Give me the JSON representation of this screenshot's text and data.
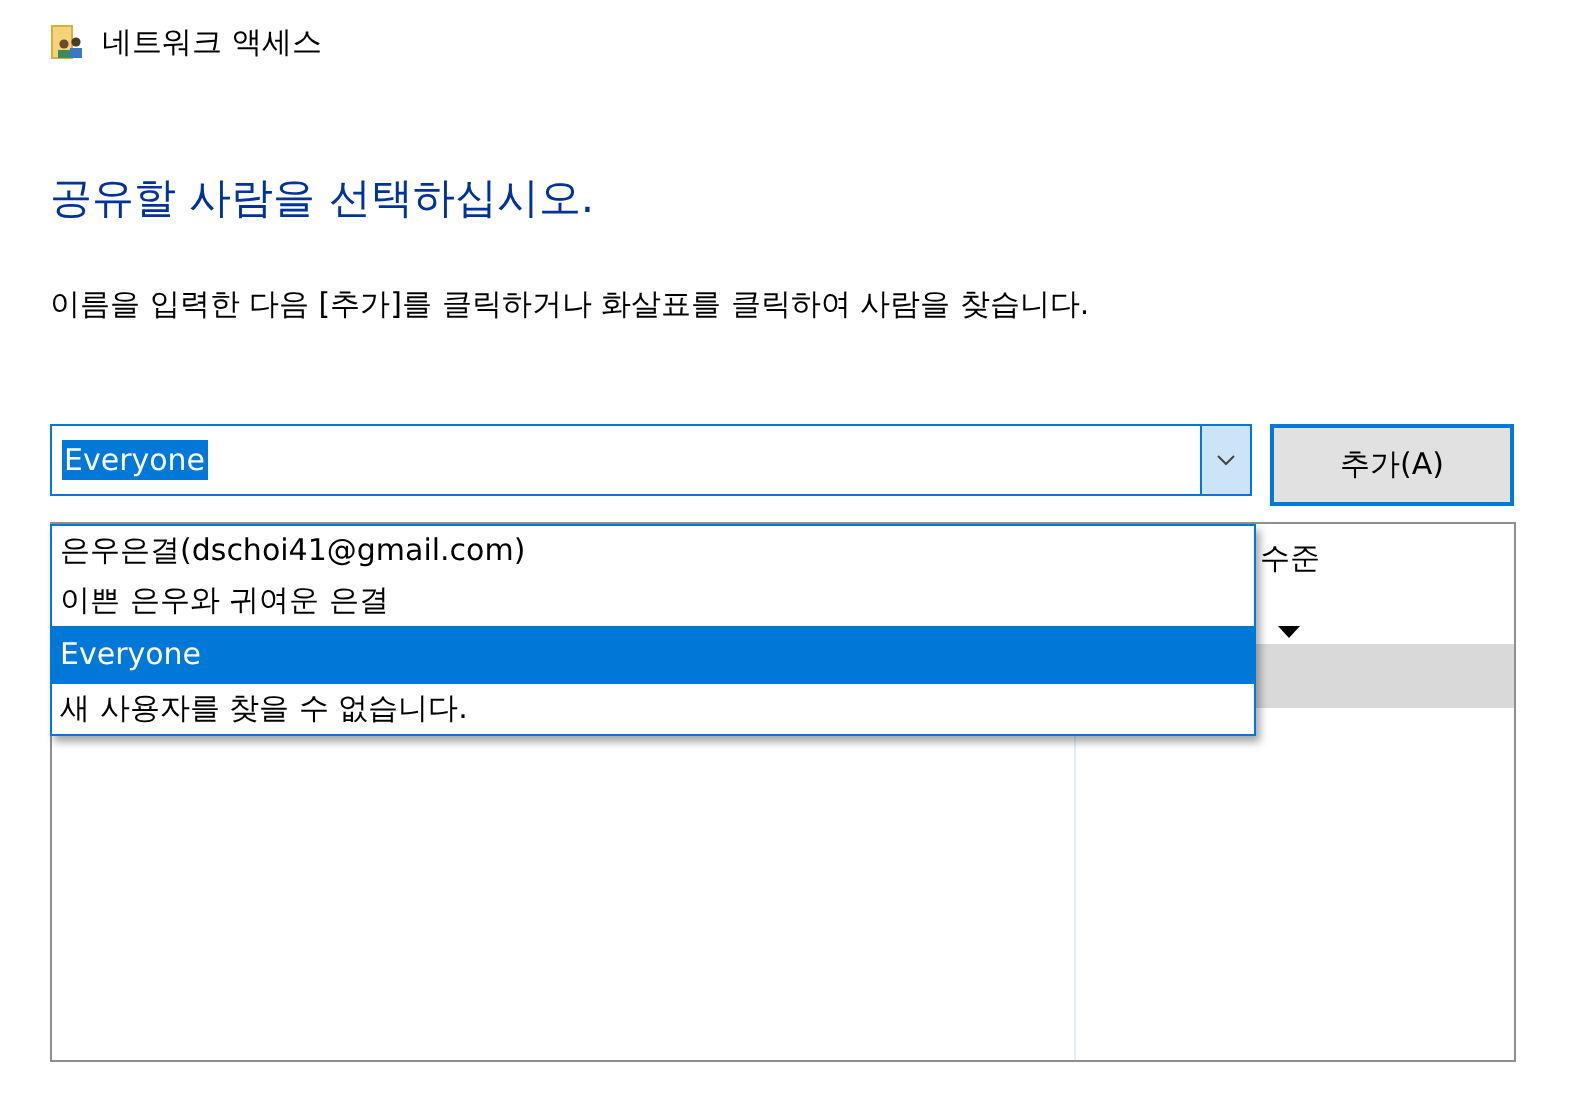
{
  "window": {
    "title": "네트워크 액세스"
  },
  "heading": "공유할 사람을 선택하십시오.",
  "instruction": "이름을 입력한 다음 [추가]를 클릭하거나 화살표를 클릭하여 사람을 찾습니다.",
  "name_combo": {
    "value": "Everyone",
    "expanded": true,
    "options": [
      {
        "label": "은우은결(dschoi41@gmail.com)",
        "selected": false
      },
      {
        "label": "이쁜 은우와 귀여운 은결",
        "selected": false
      },
      {
        "label": "Everyone",
        "selected": true
      },
      {
        "label": "새 사용자를 찾을 수 없습니다.",
        "selected": false
      }
    ]
  },
  "add_button": {
    "label": "추가(A)"
  },
  "table": {
    "column_2": "수준",
    "rows": [
      {
        "selected": false
      },
      {
        "selected": true
      }
    ]
  }
}
